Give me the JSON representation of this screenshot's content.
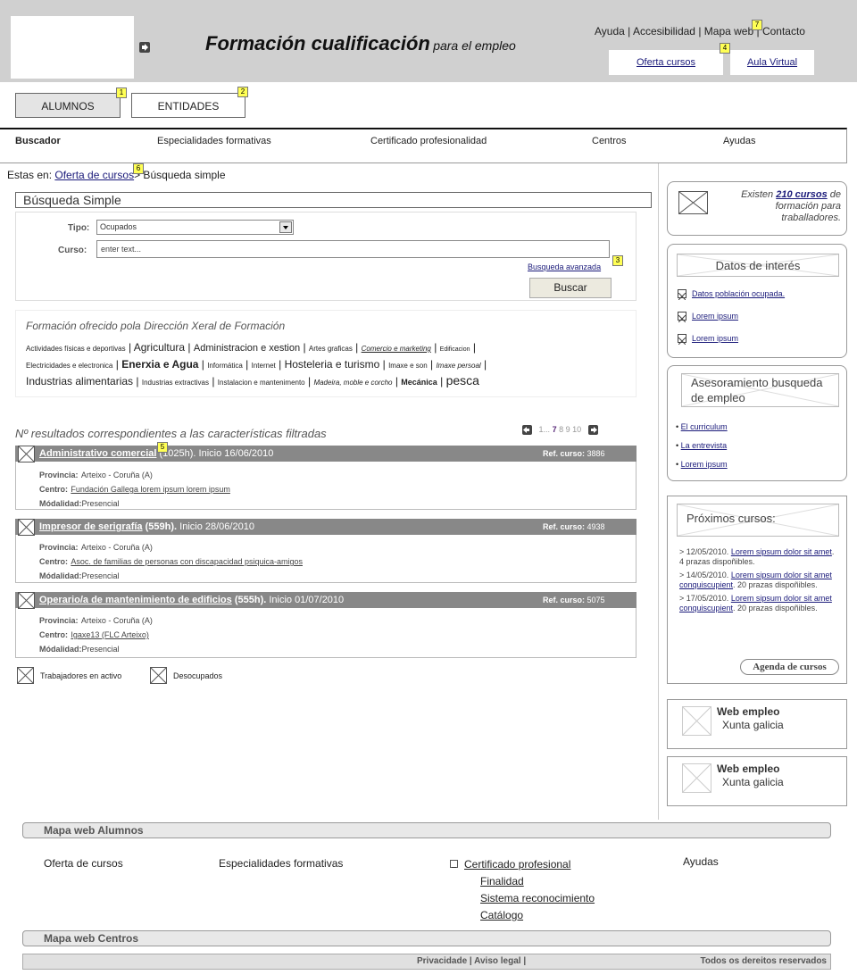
{
  "header": {
    "title": "Formación cualificación",
    "subtitle": "para el empleo",
    "top_links": [
      "Ayuda",
      "Accesibilidad",
      "Mapa web",
      "Contacto"
    ],
    "oferta_btn": "Oferta cursos",
    "aula_btn": "Aula Virtual"
  },
  "markers": [
    "1",
    "2",
    "3",
    "4",
    "5",
    "6",
    "7"
  ],
  "user_tabs": [
    "ALUMNOS",
    "ENTIDADES"
  ],
  "nav": [
    "Buscador",
    "Especialidades formativas",
    "Certificado profesionalidad",
    "Centros",
    "Ayudas"
  ],
  "breadcrumb": {
    "prefix": "Estas en:",
    "link": "Oferta de cursos",
    "current": "> Búsqueda simple"
  },
  "search": {
    "title": "Búsqueda Simple",
    "tipo_label": "Tipo:",
    "tipo_value": "Ocupados",
    "curso_label": "Curso:",
    "curso_placeholder": "enter text...",
    "advanced_link": "Busqueda avanzada",
    "button": "Buscar"
  },
  "formacion": {
    "title": "Formación ofrecido pola Dirección Xeral de Formación",
    "tags": [
      "Actividades físicas e deportivas",
      "Agricultura",
      "Administracion e xestion",
      "Artes graficas",
      "Comercio e marketing",
      "Edificacion",
      "Electricidades e electronica",
      "Enerxia e Agua",
      "Informática",
      "Internet",
      "Hosteleria e turismo",
      "Imaxe e son",
      "Imaxe persoal",
      "Industrias alimentarias",
      "Industrias extractivas",
      "Instalacion e mantenimento",
      "Madeira, moble e corcho",
      "Mecánica",
      "pesca"
    ]
  },
  "results": {
    "heading": "Nº resultados correspondientes a las características filtradas",
    "pagination": [
      "1",
      "...",
      "7",
      "8",
      "9",
      "10"
    ],
    "items": [
      {
        "title": "Administrativo comercial",
        "hours": "(1025h).",
        "start": "Inicio 16/06/2010",
        "ref_label": "Ref. curso:",
        "ref": "3886",
        "provincia_label": "Provincia:",
        "provincia": "Arteixo - Coruña (A)",
        "centro_label": "Centro:",
        "centro": "Fundación Gallega lorem ipsum lorem ipsum",
        "modalidad_label": "Módalidad:",
        "modalidad": "Presencial"
      },
      {
        "title": "Impresor de serigrafía",
        "hours": "(559h).",
        "start": "Inicio 28/06/2010",
        "ref_label": "Ref. curso:",
        "ref": "4938",
        "provincia_label": "Provincia:",
        "provincia": "Arteixo - Coruña (A)",
        "centro_label": "Centro:",
        "centro": "Asoc. de familias de personas con discapacidad psiquica-amigos",
        "modalidad_label": "Módalidad:",
        "modalidad": "Presencial"
      },
      {
        "title": "Operario/a de mantenimiento de edificios",
        "hours": "(555h).",
        "start": "Inicio 01/07/2010",
        "ref_label": "Ref. curso:",
        "ref": "5075",
        "provincia_label": "Provincia:",
        "provincia": "Arteixo - Coruña (A)",
        "centro_label": "Centro:",
        "centro": "Igaxe13 (FLC Arteixo)",
        "modalidad_label": "Módalidad:",
        "modalidad": "Presencial"
      }
    ],
    "legend": [
      "Trabajadores en activo",
      "Desocupados"
    ]
  },
  "sidebar": {
    "existen_prefix": "Existen",
    "existen_count": "210 cursos",
    "existen_suffix": "de formación para traballadores.",
    "datos_title": "Datos de interés",
    "datos_links": [
      "Datos población ocupada.",
      "Lorem ipsum",
      "Lorem ipsum"
    ],
    "aseso_title": "Asesoramiento busqueda de empleo",
    "aseso_links": [
      "El curriculum",
      "La entrevista",
      "Lorem ipsum"
    ],
    "proximos_title": "Próximos cursos:",
    "proximos": [
      {
        "date": "> 12/05/2010.",
        "link": "Lorem sipsum dolor sit amet",
        "rest": ". 4 prazas dispoñibles."
      },
      {
        "date": "> 14/05/2010.",
        "link": "Lorem sipsum dolor sit amet conquiscupient",
        "rest": ". 20 prazas dispoñibles."
      },
      {
        "date": "> 17/05/2010.",
        "link": "Lorem sipsum dolor sit amet conquiscupient",
        "rest": ". 20 prazas dispoñibles."
      }
    ],
    "agenda_btn": "Agenda de cursos",
    "web_empleo": [
      {
        "line1": "Web empleo",
        "line2": "Xunta galicia"
      },
      {
        "line1": "Web empleo",
        "line2": "Xunta galicia"
      }
    ]
  },
  "footer": {
    "map_alumnos": "Mapa web Alumnos",
    "cols": [
      "Oferta de cursos",
      "Especialidades formativas",
      "Ayudas"
    ],
    "cert_prof": "Certificado profesional",
    "cert_sub": [
      "Finalidad",
      "Sistema reconocimiento",
      "Catálogo"
    ],
    "map_centros": "Mapa web Centros",
    "privacidade": "Privacidade | Aviso legal |",
    "dereitos": "Todos os dereitos reservados"
  }
}
